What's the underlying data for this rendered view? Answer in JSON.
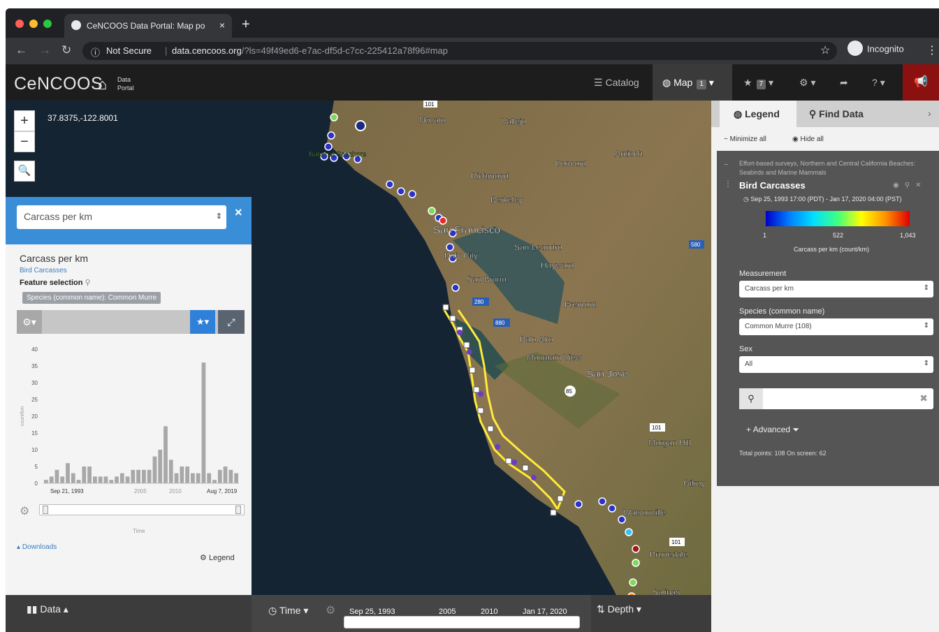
{
  "browser": {
    "tab_title": "CeNCOOS Data Portal: Map po",
    "tab_close": "×",
    "new_tab": "+",
    "security": "Not Secure",
    "url_host": "data.cencoos.org",
    "url_path": "/?ls=49f49ed6-e7ac-df5d-c7cc-225412a78f96#map",
    "incognito_label": "Incognito"
  },
  "app": {
    "logo": "CeNCOOS",
    "portal_line1": "Data",
    "portal_line2": "Portal",
    "nav": {
      "catalog": "Catalog",
      "map": "Map",
      "map_badge": "1",
      "favorites_badge": "7"
    }
  },
  "map": {
    "coords": "37.8375,-122.8001",
    "zoom_in": "+",
    "zoom_out": "−",
    "places": [
      {
        "name": "Novato"
      },
      {
        "name": "Vallejo"
      },
      {
        "name": "Concord"
      },
      {
        "name": "Antioch"
      },
      {
        "name": "Richmond"
      },
      {
        "name": "Berkeley"
      },
      {
        "name": "San Francisco"
      },
      {
        "name": "San Leandro"
      },
      {
        "name": "Hayward"
      },
      {
        "name": "Daly City"
      },
      {
        "name": "San Bruno"
      },
      {
        "name": "Fremont"
      },
      {
        "name": "Palo Alto"
      },
      {
        "name": "Mountain View"
      },
      {
        "name": "San Jose"
      },
      {
        "name": "Morgan Hill"
      },
      {
        "name": "Gilroy"
      },
      {
        "name": "Watsonville"
      },
      {
        "name": "Prunedale"
      },
      {
        "name": "Salinas"
      },
      {
        "name": "National Seashore"
      }
    ],
    "roads": [
      "101",
      "580",
      "280",
      "880",
      "85",
      "101",
      "101"
    ]
  },
  "data_panel": {
    "measurement_select": "Carcass per km",
    "close": "×",
    "title": "Carcass per km",
    "dataset_link": "Bird Carcasses",
    "feature_selection": "Feature selection",
    "filter_chip": "Species (common name): Common Murre",
    "chart_start": "Sep 21, 1993",
    "chart_end": "Aug 7, 2019",
    "chart_ticks_mid": [
      "2005",
      "2010"
    ],
    "time_label": "Time",
    "downloads": "Downloads",
    "legend": "Legend"
  },
  "chart_data": {
    "type": "bar",
    "ylabel": "count/km",
    "xlabel": "Time",
    "ylim": [
      0,
      40
    ],
    "y_ticks": [
      0,
      5,
      10,
      15,
      20,
      25,
      30,
      35,
      40
    ],
    "values": [
      1,
      2,
      4,
      2,
      6,
      3,
      1,
      5,
      5,
      2,
      2,
      2,
      1,
      2,
      3,
      2,
      4,
      4,
      4,
      4,
      8,
      10,
      17,
      7,
      3,
      5,
      5,
      3,
      3,
      36,
      3,
      1,
      4,
      5,
      4,
      3
    ]
  },
  "bottom_bar": {
    "data": "Data",
    "time": "Time",
    "depth": "Depth",
    "timeline_start": "Sep 25, 1993",
    "timeline_2005": "2005",
    "timeline_2010": "2010",
    "timeline_end": "Jan 17, 2020"
  },
  "legend_panel": {
    "tab_legend": "Legend",
    "tab_find": "Find Data",
    "minimize_all": "Minimize all",
    "hide_all": "Hide all",
    "layer_subtitle": "Effort-based surveys, Northern and Central California Beaches: Seabirds and Marine Mammals",
    "layer_title": "Bird Carcasses",
    "date_range": "Sep 25, 1993 17:00 (PDT) - Jan 17, 2020 04:00 (PST)",
    "scale_min": "1",
    "scale_mid": "522",
    "scale_max": "1,043",
    "scale_unit": "Carcass per km (count/km)",
    "measurement_label": "Measurement",
    "measurement_value": "Carcass per km",
    "species_label": "Species (common name)",
    "species_value": "Common Murre (108)",
    "sex_label": "Sex",
    "sex_value": "All",
    "advanced": "Advanced",
    "totals": "Total points: 108 On screen: 62"
  },
  "colors": {
    "accent_blue": "#3a8ed8",
    "alert_red": "#8b1111",
    "app_bar": "#1d1d1d"
  }
}
